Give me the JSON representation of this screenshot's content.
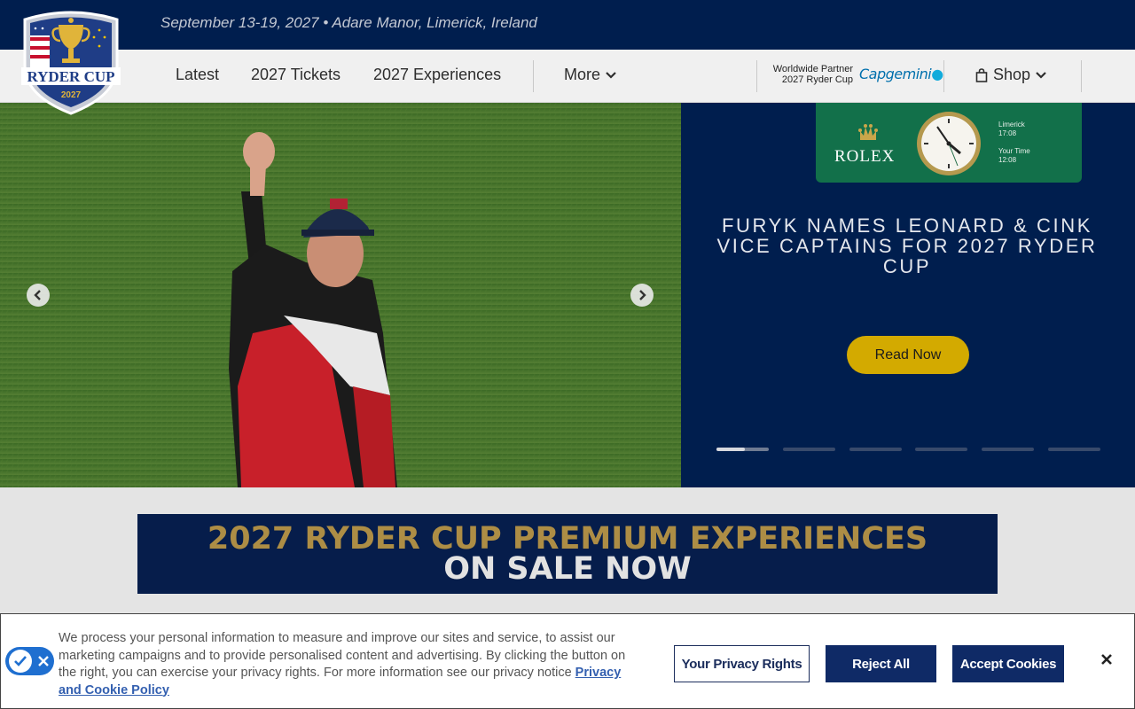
{
  "header": {
    "event_info": "September 13-19, 2027  •  Adare Manor, Limerick, Ireland",
    "logo_text": "RYDER CUP",
    "logo_year": "2027"
  },
  "nav": {
    "items": [
      "Latest",
      "2027 Tickets",
      "2027 Experiences",
      "More"
    ],
    "partner_line1": "Worldwide Partner",
    "partner_line2": "2027 Ryder Cup",
    "partner_brand": "Capgemini",
    "shop_label": "Shop"
  },
  "rolex": {
    "brand": "ROLEX",
    "location_label": "Limerick",
    "location_time": "17:08",
    "your_time_label": "Your Time",
    "your_time": "12:08"
  },
  "hero": {
    "headline": "FURYK NAMES LEONARD & CINK VICE CAPTAINS FOR 2027 RYDER CUP",
    "cta": "Read Now",
    "slide_count": 6,
    "active_slide": 1,
    "active_progress": 0.55
  },
  "banner": {
    "line1": "2027 RYDER CUP PREMIUM EXPERIENCES",
    "line2": "ON SALE NOW"
  },
  "cookie": {
    "text": "We process your personal information to measure and improve our sites and service, to assist our marketing campaigns and to provide personalised content and advertising. By clicking the button on the right, you can exercise your privacy rights. For more information see our privacy notice",
    "link": "Privacy and Cookie Policy",
    "privacy_button": "Your Privacy Rights",
    "reject_button": "Reject All",
    "accept_button": "Accept Cookies"
  },
  "colors": {
    "navy": "#001e4e",
    "gold": "#d3aa00",
    "rolex_green": "#12704a",
    "banner_gold": "#ad8d45"
  },
  "icons": [
    "chevron-left-icon",
    "chevron-right-icon",
    "chevron-down-icon",
    "shopping-bag-icon",
    "close-icon",
    "check-icon",
    "x-icon",
    "crown-icon",
    "trophy-icon"
  ]
}
